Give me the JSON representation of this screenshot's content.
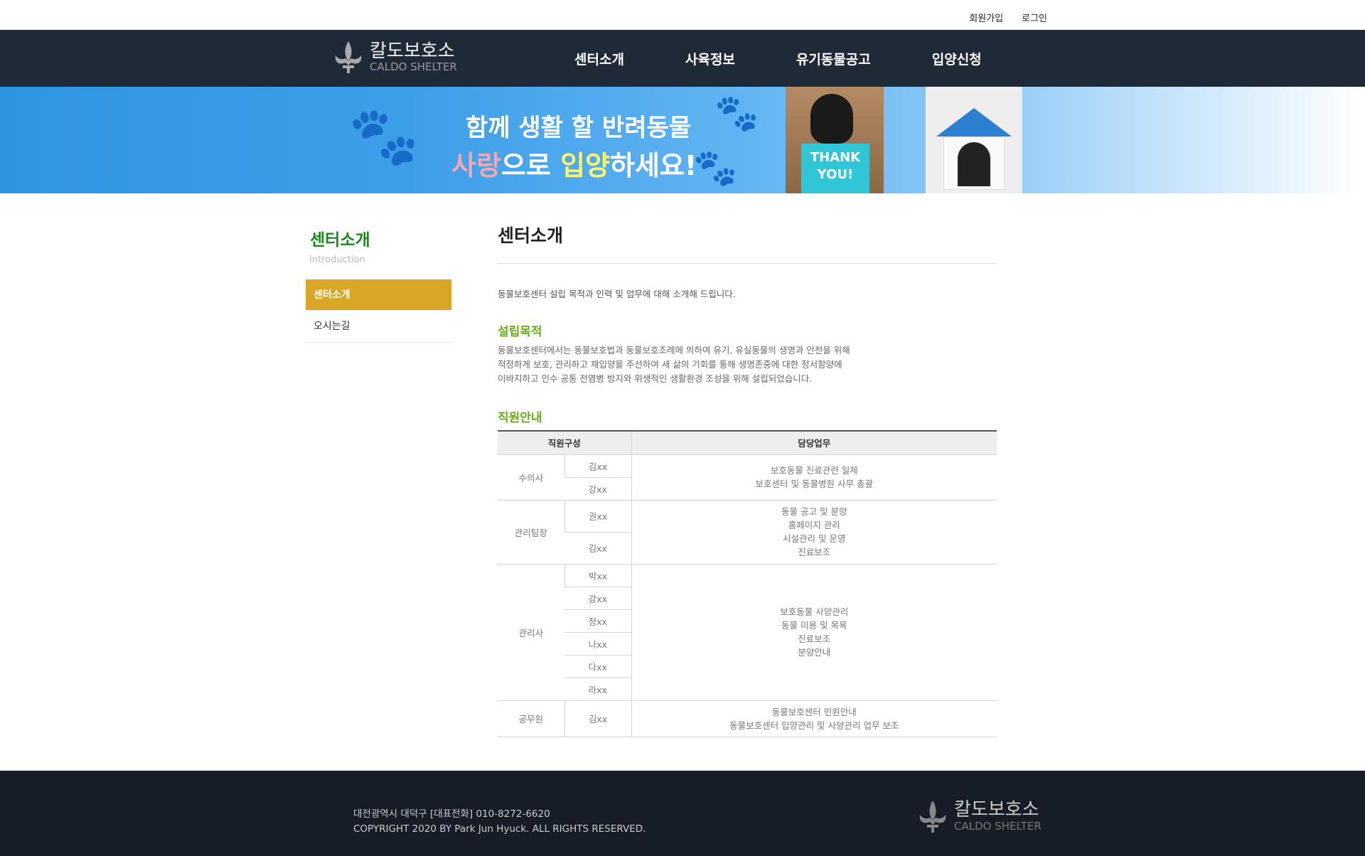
{
  "top_links": {
    "signup": "회원가입",
    "login": "로그인"
  },
  "brand": {
    "name_ko": "칼도보호소",
    "name_en": "CALDO SHELTER"
  },
  "nav": [
    "센터소개",
    "사육정보",
    "유기동물공고",
    "입양신청"
  ],
  "banner": {
    "line1": "함께 생활 할 반려동물",
    "line2_a": "사랑",
    "line2_b": "으로 ",
    "line2_c": "입양",
    "line2_d": "하세요!",
    "card": "THANK YOU!"
  },
  "sidebar": {
    "title": "센터소개",
    "subtitle": "Introduction",
    "items": [
      "센터소개",
      "오시는길"
    ]
  },
  "main": {
    "title": "센터소개",
    "intro": "동물보호센터 설립 목적과 인력 및 업무에 대해 소개해 드립니다.",
    "purpose_heading": "설립목적",
    "purpose_lines": [
      "동물보호센터에서는 동물보호법과 동물보호조례에 의하여 유기, 유실동물의 생명과 안전을 위해",
      "적정하게 보호, 관리하고 재입양을 주선하여 새 삶의 기회를 통해 생명존중에 대한 정서함양에",
      "이바지하고 인수 공통 전염병 방지와 위생적인 생활환경 조성을 위해 설립되었습니다."
    ],
    "staff_heading": "직원안내",
    "table": {
      "headers": [
        "직원구성",
        "담당업무"
      ],
      "groups": [
        {
          "role": "수의사",
          "names": [
            "김xx",
            "강xx"
          ],
          "duties": [
            "보호동물 진료관련 일체",
            "보호센터 및 동물병원 사무 총괄"
          ]
        },
        {
          "role": "관리팀장",
          "names": [
            "권xx",
            "김xx"
          ],
          "duties": [
            "동물 공고 및 분양",
            "홈페이지 관리",
            "시설관리 및 운영",
            "진료보조"
          ]
        },
        {
          "role": "관리사",
          "names": [
            "박xx",
            "강xx",
            "정xx",
            "나xx",
            "다xx",
            "라xx"
          ],
          "duties": [
            "보호동물 사양관리",
            "동물 미용 및 목욕",
            "진료보조",
            "분양안내"
          ]
        },
        {
          "role": "공무원",
          "names": [
            "김xx"
          ],
          "duties": [
            "동물보호센터 민원안내",
            "동물보호센터 입양관리 및 사양관리 업무 보조"
          ]
        }
      ]
    }
  },
  "footer": {
    "address": "대전광역시 대덕구 [대표전화] 010-8272-6620",
    "copyright": "COPYRIGHT 2020 BY Park Jun Hyuck. ALL RIGHTS RESERVED."
  }
}
